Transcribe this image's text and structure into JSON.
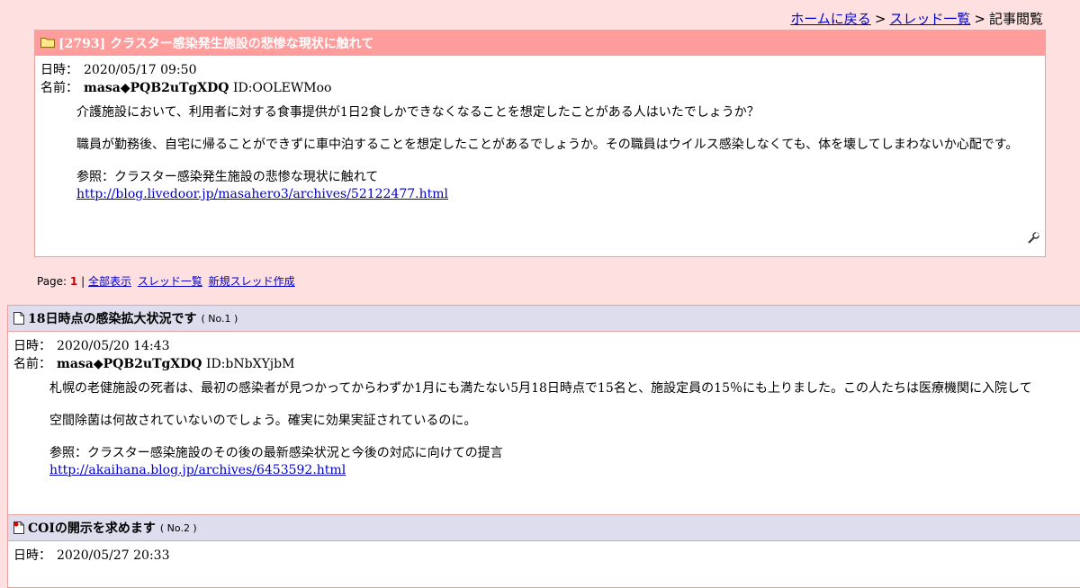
{
  "breadcrumb": {
    "home": "ホームに戻る",
    "sep1": ">",
    "threads": "スレッド一覧",
    "sep2": ">",
    "current": "記事閲覧"
  },
  "thread": {
    "title": "[2793] クラスター感染発生施設の悲惨な現状に触れて",
    "date_label": "日時：",
    "date": "2020/05/17 09:50",
    "name_label": "名前：",
    "name": "masa◆PQB2uTgXDQ",
    "id": "ID:OOLEWMoo",
    "para1": "介護施設において、利用者に対する食事提供が1日2食しかできなくなることを想定したことがある人はいたでしょうか？",
    "para2": "職員が勤務後、自宅に帰ることができずに車中泊することを想定したことがあるでしょうか。その職員はウイルス感染しなくても、体を壊してしまわないか心配です。",
    "ref": "参照：クラスター感染発生施設の悲惨な現状に触れて",
    "link": "http://blog.livedoor.jp/masahero3/archives/52122477.html"
  },
  "pager": {
    "label": "Page:",
    "current": "1",
    "sep": "|",
    "all": "全部表示",
    "list": "スレッド一覧",
    "new": "新規スレッド作成"
  },
  "reply1": {
    "title": "18日時点の感染拡大状況です",
    "no": "( No.1 )",
    "date_label": "日時：",
    "date": "2020/05/20 14:43",
    "name_label": "名前：",
    "name": "masa◆PQB2uTgXDQ",
    "id": "ID:bNbXYjbM",
    "para1": "札幌の老健施設の死者は、最初の感染者が見つかってからわずか1月にも満たない5月18日時点で15名と、施設定員の15％にも上りました。この人たちは医療機関に入院して",
    "para2": "空間除菌は何故されていないのでしょう。確実に効果実証されているのに。",
    "ref": "参照：クラスター感染施設のその後の最新感染状況と今後の対応に向けての提言",
    "link": "http://akaihana.blog.jp/archives/6453592.html"
  },
  "reply2": {
    "title": "COIの開示を求めます",
    "no": "( No.2 )",
    "date_label": "日時：",
    "date": "2020/05/27 20:33"
  }
}
